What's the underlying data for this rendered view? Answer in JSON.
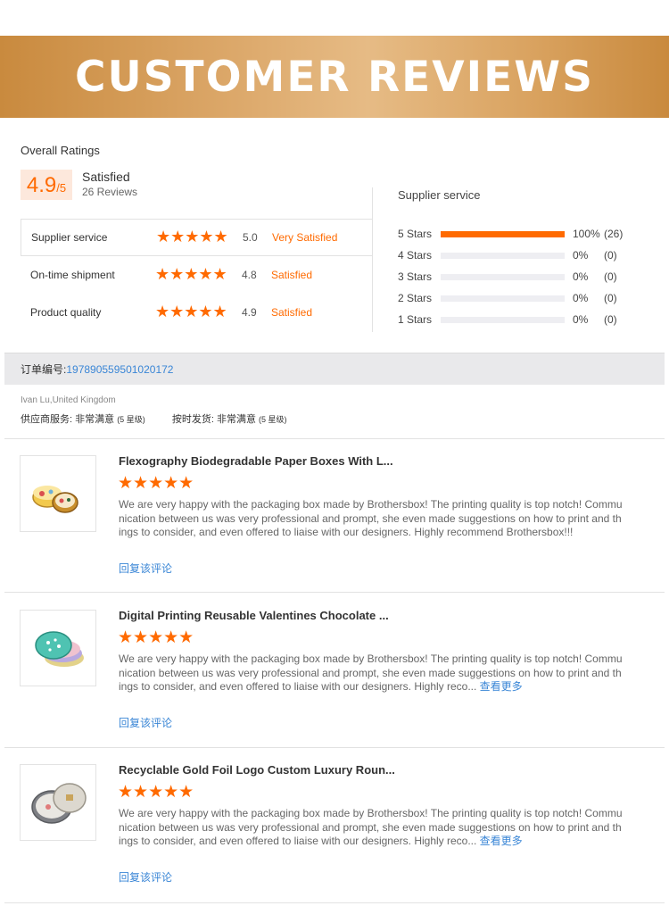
{
  "banner": {
    "title": "CUSTOMER REVIEWS"
  },
  "overall": {
    "label": "Overall Ratings",
    "score": "4.9",
    "score_suffix": "/5",
    "satisfaction": "Satisfied",
    "reviews": "26 Reviews"
  },
  "ratings": [
    {
      "label": "Supplier service",
      "stars": "★★★★★",
      "score": "5.0",
      "text": "Very Satisfied"
    },
    {
      "label": "On-time shipment",
      "stars": "★★★★★",
      "score": "4.8",
      "text": "Satisfied"
    },
    {
      "label": "Product quality",
      "stars": "★★★★★",
      "score": "4.9",
      "text": "Satisfied"
    }
  ],
  "supplier": {
    "title": "Supplier service",
    "distribution": [
      {
        "label": "5 Stars",
        "fill": 1.0,
        "pct": "100%",
        "count": "(26)"
      },
      {
        "label": "4 Stars",
        "fill": 0.0,
        "pct": "0%",
        "count": "(0)"
      },
      {
        "label": "3 Stars",
        "fill": 0.0,
        "pct": "0%",
        "count": "(0)"
      },
      {
        "label": "2 Stars",
        "fill": 0.0,
        "pct": "0%",
        "count": "(0)"
      },
      {
        "label": "1 Stars",
        "fill": 0.0,
        "pct": "0%",
        "count": "(0)"
      }
    ]
  },
  "order": {
    "label": "订单编号:",
    "number": "197890559501020172",
    "buyer": "Ivan Lu,United Kingdom",
    "service_label": "供应商服务: 非常满意",
    "service_level": "(5 星级)",
    "shipping_label": "按时发货: 非常满意",
    "shipping_level": "(5 星级)"
  },
  "reviews": [
    {
      "title": "Flexography Biodegradable Paper Boxes With L...",
      "stars": "★★★★★",
      "body": "We are very happy with the packaging box made by Brothersbox! The printing quality is top notch! Communication between us was very professional and prompt, she even made suggestions on how to print and things to consider, and even offered to liaise with our designers. Highly recommend Brothersbox!!!",
      "more": "",
      "reply": "回复该评论",
      "icon": "product-yellow-tin-icon"
    },
    {
      "title": "Digital Printing Reusable Valentines Chocolate ...",
      "stars": "★★★★★",
      "body": "We are very happy with the packaging box made by Brothersbox! The printing quality is top notch! Communication between us was very professional and prompt, she even made suggestions on how to print and things to consider, and even offered to liaise with our designers. Highly reco...",
      "more": " 查看更多",
      "reply": "回复该评论",
      "icon": "product-green-tin-icon"
    },
    {
      "title": "Recyclable Gold Foil Logo Custom Luxury Roun...",
      "stars": "★★★★★",
      "body": "We are very happy with the packaging box made by Brothersbox! The printing quality is top notch! Communication between us was very professional and prompt, she even made suggestions on how to print and things to consider, and even offered to liaise with our designers. Highly reco...",
      "more": " 查看更多",
      "reply": "回复该评论",
      "icon": "product-grey-tin-icon"
    }
  ],
  "colors": {
    "accent": "#ff6a00",
    "link": "#3a86d6",
    "banner": "#d9a25f"
  }
}
